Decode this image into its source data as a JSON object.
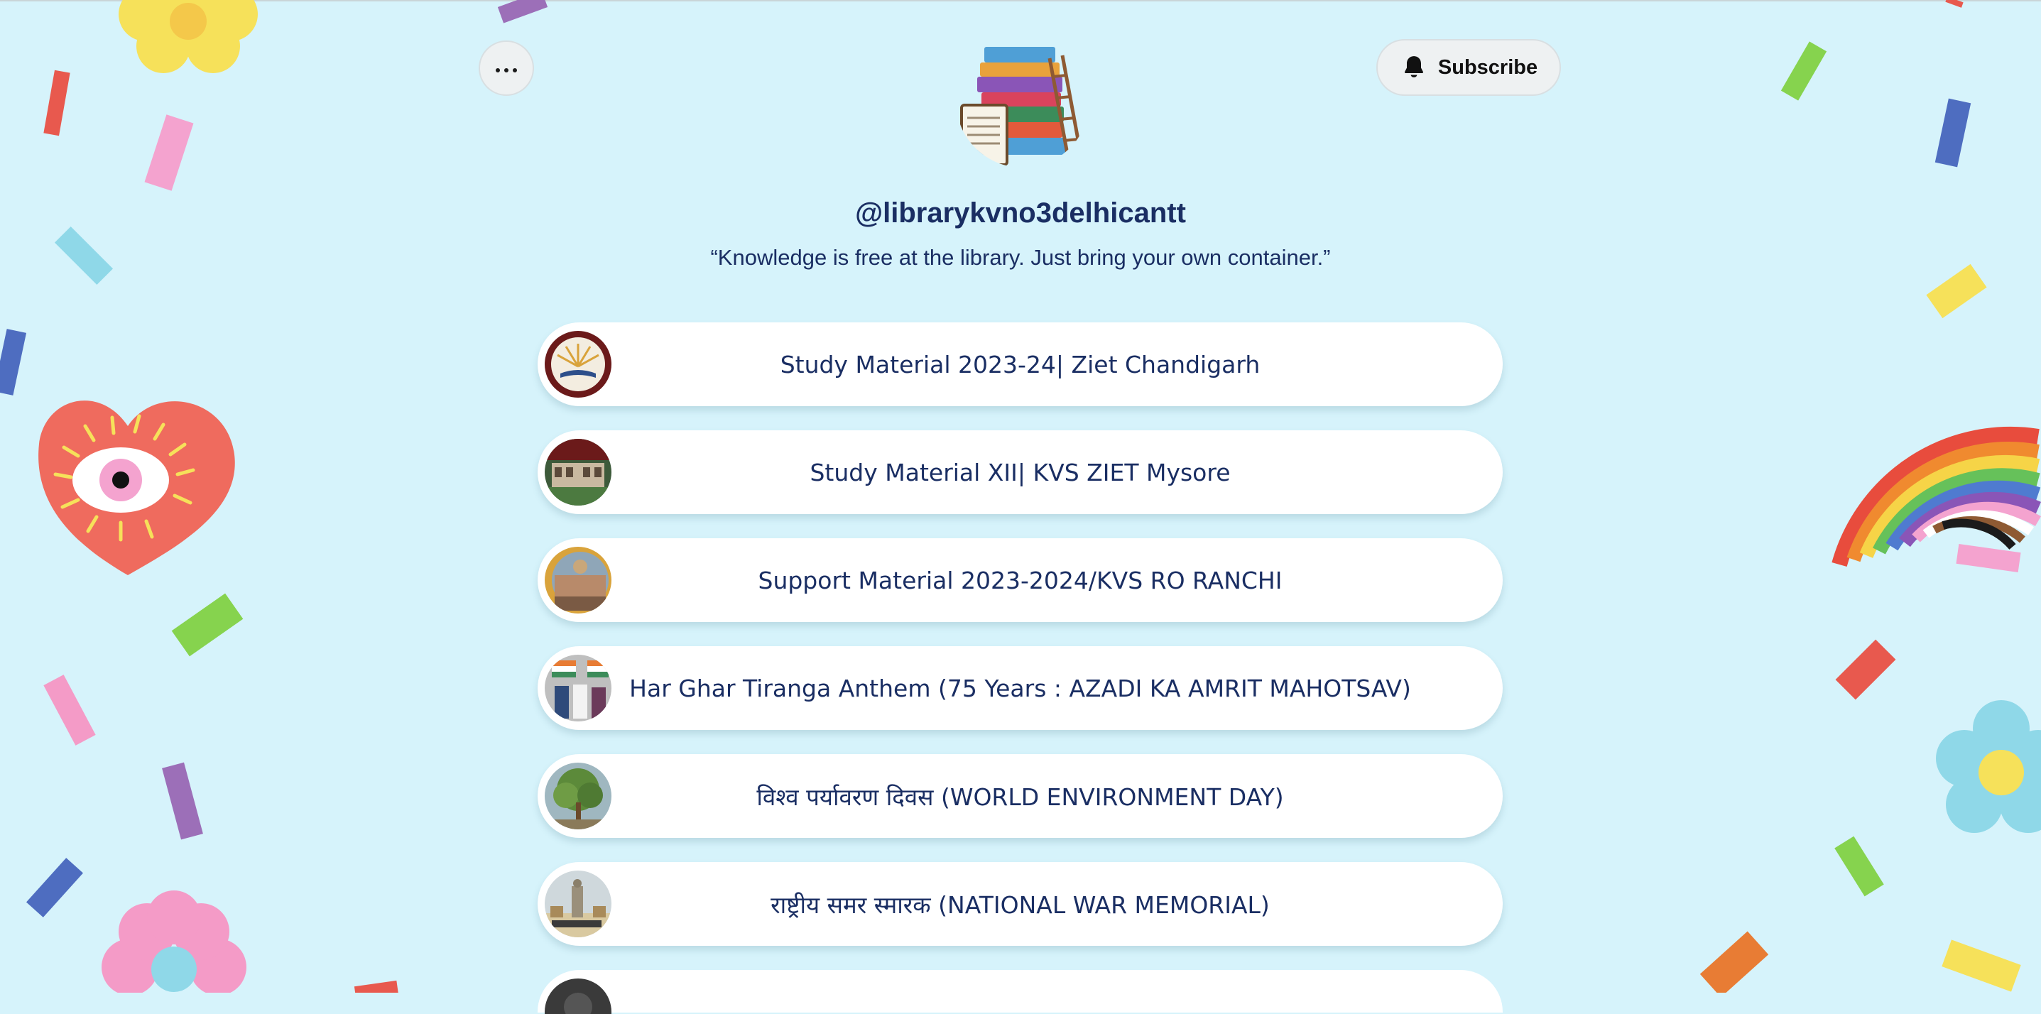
{
  "profile": {
    "handle": "@librarykvno3delhicantt",
    "bio": "“Knowledge is free at the library. Just bring your own container.”"
  },
  "header": {
    "more_icon": "more-horizontal-icon",
    "subscribe_label": "Subscribe",
    "subscribe_icon": "bell-icon"
  },
  "links": [
    {
      "label": "Study Material 2023-24| Ziet Chandigarh"
    },
    {
      "label": "Study Material XII| KVS ZIET Mysore"
    },
    {
      "label": "Support Material 2023-2024/KVS RO RANCHI"
    },
    {
      "label": "Har Ghar Tiranga Anthem (75 Years : AZADI KA AMRIT MAHOTSAV)"
    },
    {
      "label": "विश्व पर्यावरण दिवस (WORLD ENVIRONMENT DAY)"
    },
    {
      "label": "राष्ट्रीय समर स्मारक (NATIONAL WAR MEMORIAL)"
    }
  ],
  "colors": {
    "background": "#d6f3fb",
    "text": "#1a2e63",
    "button_bg": "#eef1f2",
    "link_bg": "#ffffff"
  }
}
